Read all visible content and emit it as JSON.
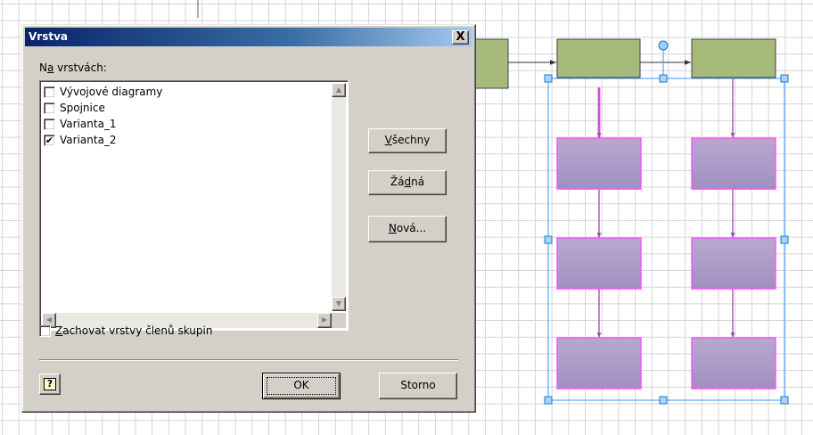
{
  "dialog": {
    "title": "Vrstva",
    "close_label": "X",
    "layers_label_prefix": "N",
    "layers_label_accel": "a",
    "layers_label_rest": " vrstvách:",
    "layers": [
      {
        "label": "Vývojové diagramy",
        "checked": false
      },
      {
        "label": "Spojnice",
        "checked": false
      },
      {
        "label": "Varianta_1",
        "checked": false
      },
      {
        "label": "Varianta_2",
        "checked": true
      }
    ],
    "checkmark": "✔",
    "scroll_up": "▲",
    "scroll_down": "▼",
    "scroll_left": "◀",
    "scroll_right": "▶",
    "all_button": {
      "accel": "V",
      "rest": "šechny"
    },
    "none_button": {
      "pre": "Žá",
      "accel": "d",
      "rest": "ná"
    },
    "new_button": {
      "accel": "N",
      "rest": "ová..."
    },
    "keep_layers": {
      "checked": false,
      "accel": "Z",
      "rest": "achovat vrstvy členů skupin"
    },
    "help_icon_glyph": "?",
    "ok_label": "OK",
    "cancel_label": "Storno"
  },
  "colors": {
    "titlebar_start": "#0a246a",
    "dialog_face": "#d4d0c8",
    "green_shape": "#a7b97b",
    "purple_shape": "#b0a0c8",
    "magenta_connector": "#ff55ff",
    "selection_handle": "#3399ff"
  }
}
